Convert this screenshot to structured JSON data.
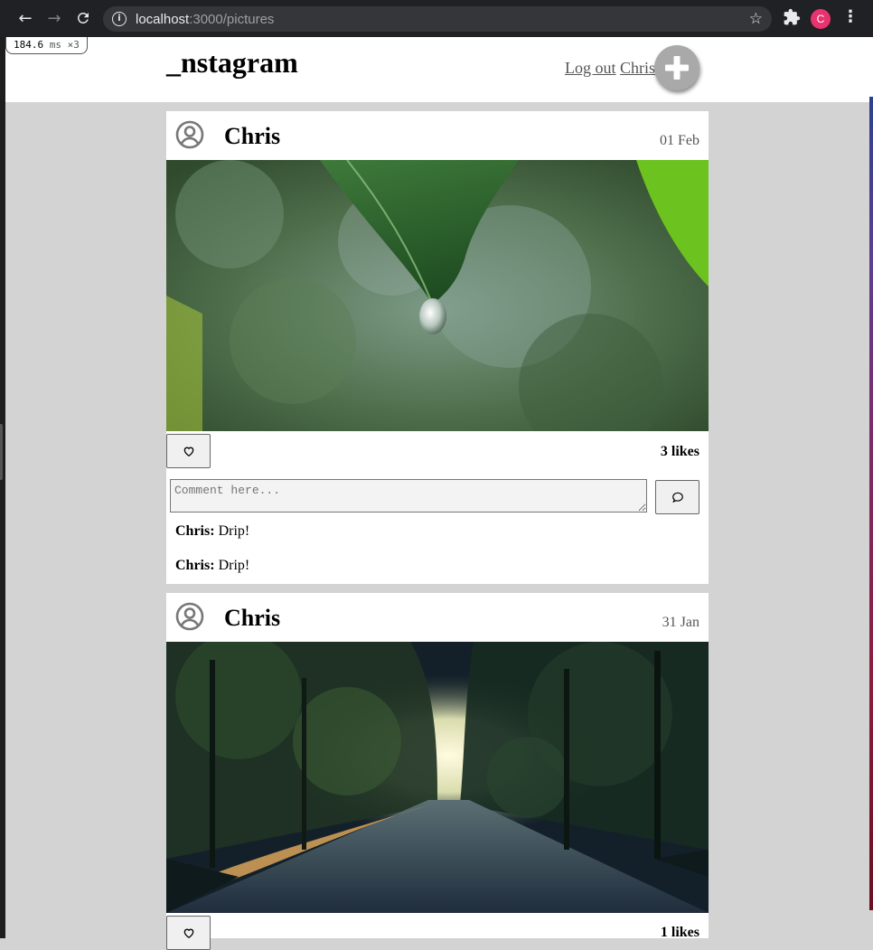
{
  "browser": {
    "url_host": "localhost",
    "url_rest": ":3000/pictures",
    "profile_initial": "C"
  },
  "perf_badge": {
    "value": "184.6",
    "unit": "ms",
    "multiplier": "×3"
  },
  "header": {
    "logo": "_nstagram",
    "logout_label": "Log out",
    "user_label": "Chris",
    "add_icon": "plus-icon"
  },
  "posts": [
    {
      "author": "Chris",
      "date": "01 Feb",
      "image": "leaf-water-drop",
      "likes": "3 likes",
      "comment_placeholder": "Comment here...",
      "comments": [
        {
          "author": "Chris:",
          "text": "Drip!"
        },
        {
          "author": "Chris:",
          "text": "Drip!"
        }
      ]
    },
    {
      "author": "Chris",
      "date": "31 Jan",
      "image": "tree-lined-road-sunrise",
      "likes": "1 likes"
    }
  ],
  "colors": {
    "background": "#d3d3d3",
    "card": "#ffffff",
    "add_button": "#a9a9a9",
    "link": "#555555"
  }
}
